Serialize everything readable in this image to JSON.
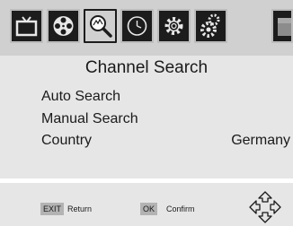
{
  "tabs": [
    {
      "icon": "tv-icon",
      "active": false
    },
    {
      "icon": "film-reel-icon",
      "active": false
    },
    {
      "icon": "search-icon",
      "active": true
    },
    {
      "icon": "clock-icon",
      "active": false
    },
    {
      "icon": "gear-icon",
      "active": false
    },
    {
      "icon": "tools-icon",
      "active": false
    },
    {
      "icon": "usb-icon",
      "active": false
    }
  ],
  "menu": {
    "title": "Channel Search",
    "items": [
      {
        "label": "Auto Search",
        "value": ""
      },
      {
        "label": "Manual Search",
        "value": ""
      },
      {
        "label": "Country",
        "value": "Germany"
      }
    ]
  },
  "footer": {
    "exit_key": "EXIT",
    "exit_label": "Return",
    "ok_key": "OK",
    "ok_label": "Confirm",
    "nav_icon": "direction-pad-icon"
  }
}
